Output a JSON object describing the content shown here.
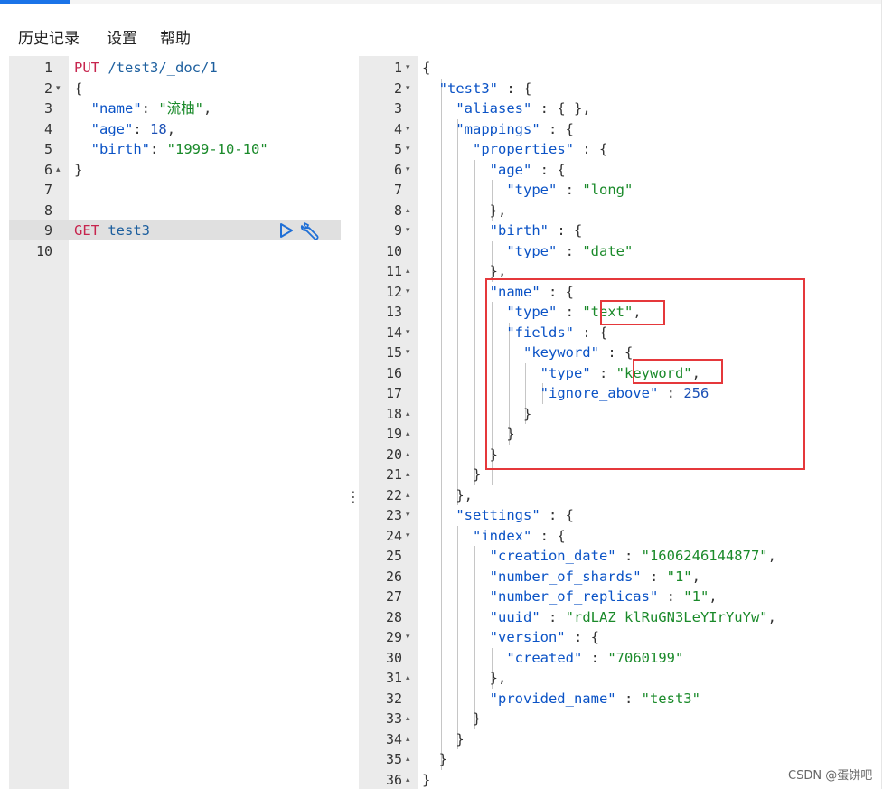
{
  "menu": {
    "history": "历史记录",
    "settings": "设置",
    "help": "帮助"
  },
  "request": {
    "lines": [
      {
        "n": "1",
        "tokens": [
          [
            "k-method",
            "PUT"
          ],
          [
            "k-url",
            " /test3/_doc/1"
          ]
        ]
      },
      {
        "n": "2",
        "tokens": [
          [
            "k-punc",
            "{"
          ]
        ]
      },
      {
        "n": "3",
        "tokens": [
          [
            "k-punc",
            "  "
          ],
          [
            "k-key",
            "\"name\""
          ],
          [
            "k-punc",
            ": "
          ],
          [
            "k-str",
            "\"流柚\""
          ],
          [
            "k-punc",
            ","
          ]
        ]
      },
      {
        "n": "4",
        "tokens": [
          [
            "k-punc",
            "  "
          ],
          [
            "k-key",
            "\"age\""
          ],
          [
            "k-punc",
            ": "
          ],
          [
            "k-num",
            "18"
          ],
          [
            "k-punc",
            ","
          ]
        ]
      },
      {
        "n": "5",
        "tokens": [
          [
            "k-punc",
            "  "
          ],
          [
            "k-key",
            "\"birth\""
          ],
          [
            "k-punc",
            ": "
          ],
          [
            "k-str",
            "\"1999-10-10\""
          ]
        ]
      },
      {
        "n": "6",
        "tokens": [
          [
            "k-punc",
            "}"
          ]
        ]
      },
      {
        "n": "7",
        "tokens": []
      },
      {
        "n": "8",
        "tokens": []
      },
      {
        "n": "9",
        "tokens": [
          [
            "k-method",
            "GET"
          ],
          [
            "k-url",
            " test3"
          ]
        ]
      },
      {
        "n": "10",
        "tokens": []
      }
    ]
  },
  "response": {
    "lines": [
      {
        "n": "1",
        "tokens": [
          [
            "k-punc",
            "{"
          ]
        ]
      },
      {
        "n": "2",
        "tokens": [
          [
            "k-punc",
            "  "
          ],
          [
            "k-key",
            "\"test3\""
          ],
          [
            "k-punc",
            " : {"
          ]
        ]
      },
      {
        "n": "3",
        "tokens": [
          [
            "k-punc",
            "    "
          ],
          [
            "k-key",
            "\"aliases\""
          ],
          [
            "k-punc",
            " : { },"
          ]
        ]
      },
      {
        "n": "4",
        "tokens": [
          [
            "k-punc",
            "    "
          ],
          [
            "k-key",
            "\"mappings\""
          ],
          [
            "k-punc",
            " : {"
          ]
        ]
      },
      {
        "n": "5",
        "tokens": [
          [
            "k-punc",
            "      "
          ],
          [
            "k-key",
            "\"properties\""
          ],
          [
            "k-punc",
            " : {"
          ]
        ]
      },
      {
        "n": "6",
        "tokens": [
          [
            "k-punc",
            "        "
          ],
          [
            "k-key",
            "\"age\""
          ],
          [
            "k-punc",
            " : {"
          ]
        ]
      },
      {
        "n": "7",
        "tokens": [
          [
            "k-punc",
            "          "
          ],
          [
            "k-key",
            "\"type\""
          ],
          [
            "k-punc",
            " : "
          ],
          [
            "k-str",
            "\"long\""
          ]
        ]
      },
      {
        "n": "8",
        "tokens": [
          [
            "k-punc",
            "        },"
          ]
        ]
      },
      {
        "n": "9",
        "tokens": [
          [
            "k-punc",
            "        "
          ],
          [
            "k-key",
            "\"birth\""
          ],
          [
            "k-punc",
            " : {"
          ]
        ]
      },
      {
        "n": "10",
        "tokens": [
          [
            "k-punc",
            "          "
          ],
          [
            "k-key",
            "\"type\""
          ],
          [
            "k-punc",
            " : "
          ],
          [
            "k-str",
            "\"date\""
          ]
        ]
      },
      {
        "n": "11",
        "tokens": [
          [
            "k-punc",
            "        },"
          ]
        ]
      },
      {
        "n": "12",
        "tokens": [
          [
            "k-punc",
            "        "
          ],
          [
            "k-key",
            "\"name\""
          ],
          [
            "k-punc",
            " : {"
          ]
        ]
      },
      {
        "n": "13",
        "tokens": [
          [
            "k-punc",
            "          "
          ],
          [
            "k-key",
            "\"type\""
          ],
          [
            "k-punc",
            " : "
          ],
          [
            "k-str",
            "\"text\""
          ],
          [
            "k-punc",
            ","
          ]
        ]
      },
      {
        "n": "14",
        "tokens": [
          [
            "k-punc",
            "          "
          ],
          [
            "k-key",
            "\"fields\""
          ],
          [
            "k-punc",
            " : {"
          ]
        ]
      },
      {
        "n": "15",
        "tokens": [
          [
            "k-punc",
            "            "
          ],
          [
            "k-key",
            "\"keyword\""
          ],
          [
            "k-punc",
            " : {"
          ]
        ]
      },
      {
        "n": "16",
        "tokens": [
          [
            "k-punc",
            "              "
          ],
          [
            "k-key",
            "\"type\""
          ],
          [
            "k-punc",
            " : "
          ],
          [
            "k-str",
            "\"keyword\""
          ],
          [
            "k-punc",
            ","
          ]
        ]
      },
      {
        "n": "17",
        "tokens": [
          [
            "k-punc",
            "              "
          ],
          [
            "k-key",
            "\"ignore_above\""
          ],
          [
            "k-punc",
            " : "
          ],
          [
            "k-num",
            "256"
          ]
        ]
      },
      {
        "n": "18",
        "tokens": [
          [
            "k-punc",
            "            }"
          ]
        ]
      },
      {
        "n": "19",
        "tokens": [
          [
            "k-punc",
            "          }"
          ]
        ]
      },
      {
        "n": "20",
        "tokens": [
          [
            "k-punc",
            "        }"
          ]
        ]
      },
      {
        "n": "21",
        "tokens": [
          [
            "k-punc",
            "      }"
          ]
        ]
      },
      {
        "n": "22",
        "tokens": [
          [
            "k-punc",
            "    },"
          ]
        ]
      },
      {
        "n": "23",
        "tokens": [
          [
            "k-punc",
            "    "
          ],
          [
            "k-key",
            "\"settings\""
          ],
          [
            "k-punc",
            " : {"
          ]
        ]
      },
      {
        "n": "24",
        "tokens": [
          [
            "k-punc",
            "      "
          ],
          [
            "k-key",
            "\"index\""
          ],
          [
            "k-punc",
            " : {"
          ]
        ]
      },
      {
        "n": "25",
        "tokens": [
          [
            "k-punc",
            "        "
          ],
          [
            "k-key",
            "\"creation_date\""
          ],
          [
            "k-punc",
            " : "
          ],
          [
            "k-str",
            "\"1606246144877\""
          ],
          [
            "k-punc",
            ","
          ]
        ]
      },
      {
        "n": "26",
        "tokens": [
          [
            "k-punc",
            "        "
          ],
          [
            "k-key",
            "\"number_of_shards\""
          ],
          [
            "k-punc",
            " : "
          ],
          [
            "k-str",
            "\"1\""
          ],
          [
            "k-punc",
            ","
          ]
        ]
      },
      {
        "n": "27",
        "tokens": [
          [
            "k-punc",
            "        "
          ],
          [
            "k-key",
            "\"number_of_replicas\""
          ],
          [
            "k-punc",
            " : "
          ],
          [
            "k-str",
            "\"1\""
          ],
          [
            "k-punc",
            ","
          ]
        ]
      },
      {
        "n": "28",
        "tokens": [
          [
            "k-punc",
            "        "
          ],
          [
            "k-key",
            "\"uuid\""
          ],
          [
            "k-punc",
            " : "
          ],
          [
            "k-str",
            "\"rdLAZ_klRuGN3LeYIrYuYw\""
          ],
          [
            "k-punc",
            ","
          ]
        ]
      },
      {
        "n": "29",
        "tokens": [
          [
            "k-punc",
            "        "
          ],
          [
            "k-key",
            "\"version\""
          ],
          [
            "k-punc",
            " : {"
          ]
        ]
      },
      {
        "n": "30",
        "tokens": [
          [
            "k-punc",
            "          "
          ],
          [
            "k-key",
            "\"created\""
          ],
          [
            "k-punc",
            " : "
          ],
          [
            "k-str",
            "\"7060199\""
          ]
        ]
      },
      {
        "n": "31",
        "tokens": [
          [
            "k-punc",
            "        },"
          ]
        ]
      },
      {
        "n": "32",
        "tokens": [
          [
            "k-punc",
            "        "
          ],
          [
            "k-key",
            "\"provided_name\""
          ],
          [
            "k-punc",
            " : "
          ],
          [
            "k-str",
            "\"test3\""
          ]
        ]
      },
      {
        "n": "33",
        "tokens": [
          [
            "k-punc",
            "      }"
          ]
        ]
      },
      {
        "n": "34",
        "tokens": [
          [
            "k-punc",
            "    }"
          ]
        ]
      },
      {
        "n": "35",
        "tokens": [
          [
            "k-punc",
            "  }"
          ]
        ]
      },
      {
        "n": "36",
        "tokens": [
          [
            "k-punc",
            "}"
          ]
        ]
      }
    ]
  },
  "icons": {
    "run": "play-icon",
    "settings": "wrench-icon"
  },
  "watermark": "CSDN @蛋饼吧"
}
